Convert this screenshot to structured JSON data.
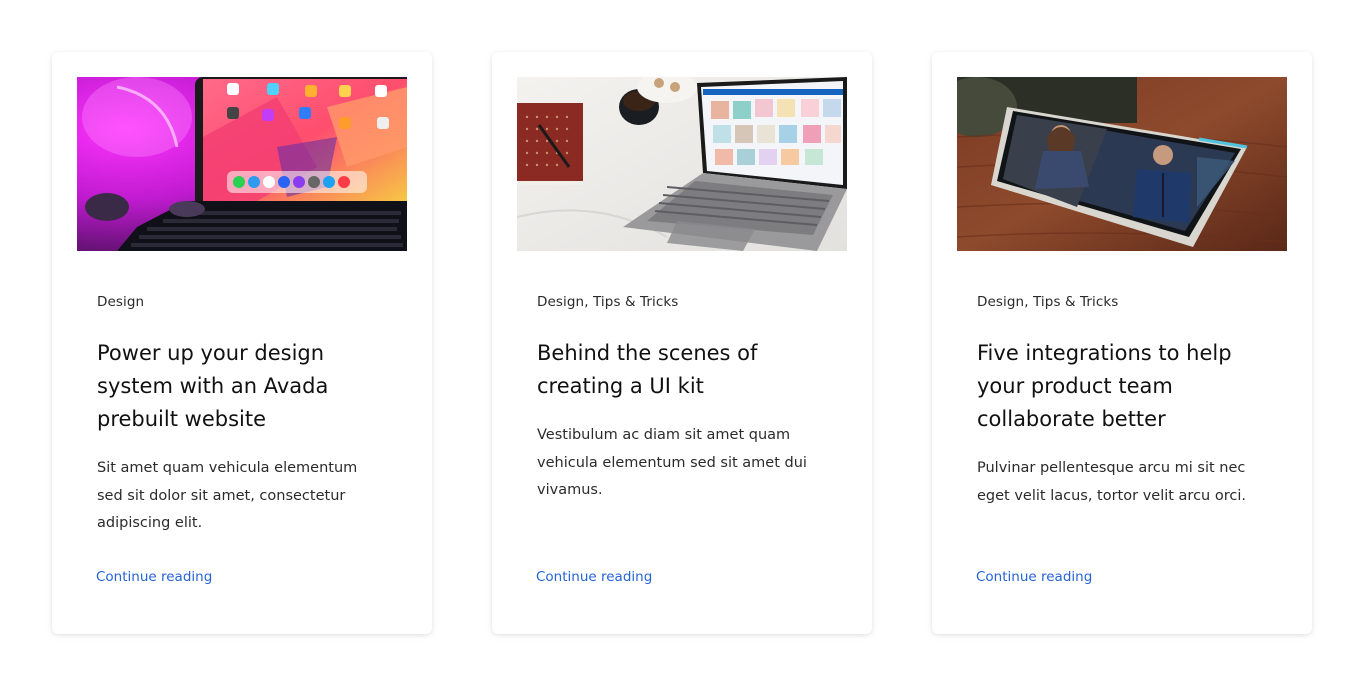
{
  "posts": [
    {
      "image_icon": "ipad-keyboard-image",
      "categories": "Design",
      "title": "Power up your design system with an Avada prebuilt website",
      "excerpt": "Sit amet quam vehicula elementum sed sit dolor sit amet, consectetur adipiscing elit.",
      "link_label": "Continue reading"
    },
    {
      "image_icon": "laptop-desk-image",
      "categories": "Design, Tips & Tricks",
      "title": "Behind the scenes of creating a UI kit",
      "excerpt": "Vestibulum ac diam sit amet quam vehicula elementum sed sit amet dui vivamus.",
      "link_label": "Continue reading"
    },
    {
      "image_icon": "tablet-on-wood-table-image",
      "categories": "Design, Tips & Tricks",
      "title": "Five integrations to help your product team collaborate better",
      "excerpt": "Pulvinar pellentesque arcu mi sit nec eget velit lacus, tortor velit arcu orci.",
      "link_label": "Continue reading"
    }
  ],
  "colors": {
    "link": "#2563d6",
    "heading": "#111111",
    "body_text": "#2b2b2b",
    "card_background": "#ffffff"
  }
}
